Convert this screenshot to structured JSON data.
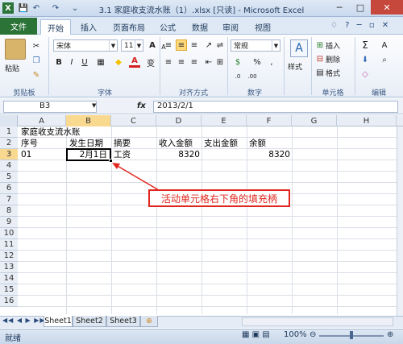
{
  "window": {
    "title": "3.1 家庭收支流水账（1）.xlsx [只读] - Microsoft Excel",
    "minimize": "─",
    "maximize": "□",
    "close": "✕"
  },
  "quick_access": [
    "X",
    "💾",
    "↶",
    "↷",
    "⌄"
  ],
  "tabs": {
    "file": "文件",
    "items": [
      "开始",
      "插入",
      "页面布局",
      "公式",
      "数据",
      "审阅",
      "视图"
    ],
    "active": "开始"
  },
  "ribbon": {
    "clipboard": {
      "paste": "粘贴",
      "group": "剪贴板"
    },
    "font": {
      "name": "宋体",
      "size": "11",
      "bold": "B",
      "italic": "I",
      "underline": "U",
      "grow": "A",
      "shrink": "A",
      "color_letter": "A",
      "wen": "变",
      "group": "字体"
    },
    "align": {
      "group": "对齐方式"
    },
    "number": {
      "format": "常规",
      "percent": "%",
      "comma": ",",
      "group": "数字",
      "dec_inc": ".0",
      "dec_dec": ".00"
    },
    "styles": {
      "label": "样式",
      "group": "单元格"
    },
    "cells": {
      "insert": "插入",
      "delete": "删除",
      "format": "格式",
      "group": "单元格"
    },
    "editing": {
      "sum": "Σ",
      "sort": "A",
      "group": "编辑"
    }
  },
  "formula_bar": {
    "name_box": "B3",
    "fx": "fx",
    "value": "2013/2/1"
  },
  "columns": [
    "A",
    "B",
    "C",
    "D",
    "E",
    "F",
    "G",
    "H"
  ],
  "rows": [
    "1",
    "2",
    "3",
    "4",
    "5",
    "6",
    "7",
    "8",
    "9",
    "10",
    "11",
    "12",
    "13",
    "14",
    "15",
    "16"
  ],
  "cells": {
    "A1": "家庭收支流水账",
    "A2": "序号",
    "B2": "发生日期",
    "C2": "摘要",
    "D2": "收入金额",
    "E2": "支出金额",
    "F2": "余额",
    "A3": "01",
    "B3": "2月1日",
    "C3": "工资",
    "D3": "8320",
    "F3": "8320"
  },
  "annotation": "活动单元格右下角的填充柄",
  "sheets": [
    "Sheet1",
    "Sheet2",
    "Sheet3"
  ],
  "status": {
    "mode": "就绪",
    "zoom": "100%"
  },
  "colors": {
    "file_tab": "#2b7337",
    "annotation": "#e0271f",
    "accent": "#1e395b"
  }
}
